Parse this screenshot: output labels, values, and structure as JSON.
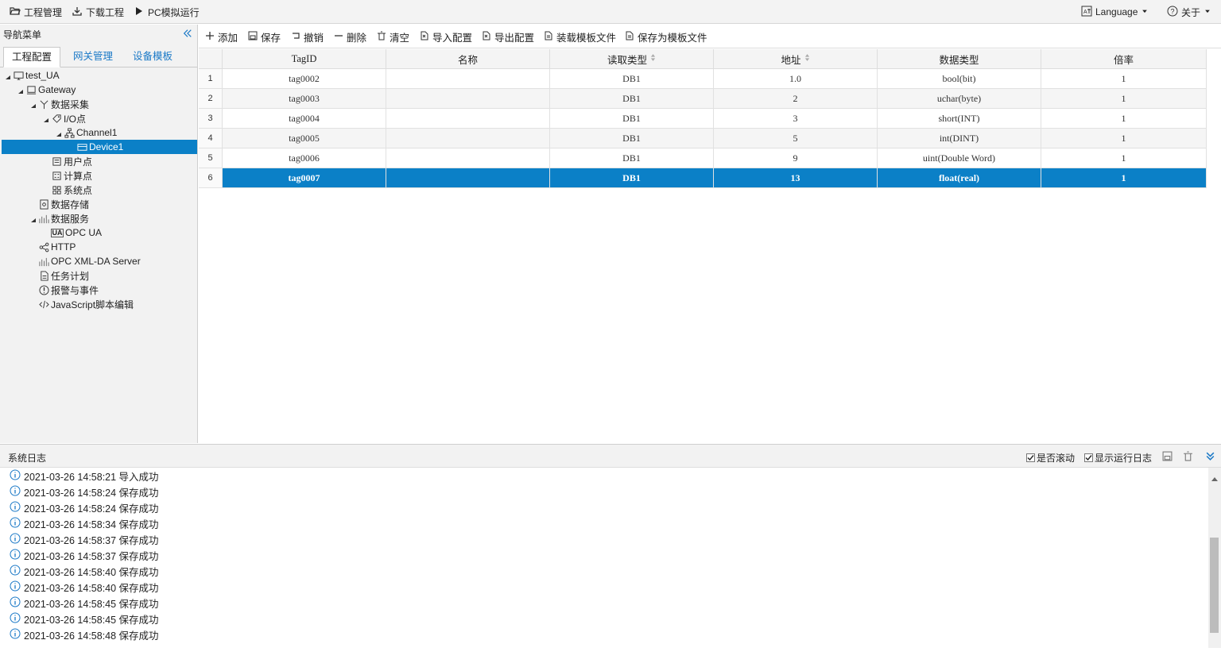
{
  "topbar": {
    "project": "工程管理",
    "download": "下载工程",
    "simulate": "PC模拟运行",
    "language": "Language",
    "about": "关于"
  },
  "nav": {
    "title": "导航菜单",
    "tabs": [
      "工程配置",
      "网关管理",
      "设备模板"
    ],
    "tree": [
      {
        "label": "test_UA",
        "icon": "monitor-icon"
      },
      {
        "label": "Gateway",
        "icon": "gateway-icon"
      },
      {
        "label": "数据采集",
        "icon": "collect-icon"
      },
      {
        "label": "I/O点",
        "icon": "tag-icon"
      },
      {
        "label": "Channel1",
        "icon": "channel-icon"
      },
      {
        "label": "Device1",
        "icon": "device-icon"
      },
      {
        "label": "用户点",
        "icon": "user-point-icon"
      },
      {
        "label": "计算点",
        "icon": "calc-point-icon"
      },
      {
        "label": "系统点",
        "icon": "system-point-icon"
      },
      {
        "label": "数据存储",
        "icon": "storage-icon"
      },
      {
        "label": "数据服务",
        "icon": "service-icon"
      },
      {
        "label": "OPC UA",
        "icon": "opcua-icon",
        "badge": "UA"
      },
      {
        "label": "HTTP",
        "icon": "share-icon"
      },
      {
        "label": "OPC XML-DA Server",
        "icon": "chart-icon"
      },
      {
        "label": "任务计划",
        "icon": "document-icon"
      },
      {
        "label": "报警与事件",
        "icon": "alert-icon"
      },
      {
        "label": "JavaScript脚本编辑",
        "icon": "code-icon"
      }
    ]
  },
  "toolbar": {
    "add": "添加",
    "save": "保存",
    "undo": "撤销",
    "delete": "删除",
    "clear": "清空",
    "import": "导入配置",
    "export": "导出配置",
    "load_template": "装载模板文件",
    "save_template": "保存为模板文件"
  },
  "grid": {
    "columns": [
      "TagID",
      "名称",
      "读取类型",
      "地址",
      "数据类型",
      "倍率"
    ],
    "rows": [
      {
        "n": "1",
        "tagid": "tag0002",
        "name": "",
        "read": "DB1",
        "addr": "1.0",
        "dtype": "bool(bit)",
        "rate": "1"
      },
      {
        "n": "2",
        "tagid": "tag0003",
        "name": "",
        "read": "DB1",
        "addr": "2",
        "dtype": "uchar(byte)",
        "rate": "1"
      },
      {
        "n": "3",
        "tagid": "tag0004",
        "name": "",
        "read": "DB1",
        "addr": "3",
        "dtype": "short(INT)",
        "rate": "1"
      },
      {
        "n": "4",
        "tagid": "tag0005",
        "name": "",
        "read": "DB1",
        "addr": "5",
        "dtype": "int(DINT)",
        "rate": "1"
      },
      {
        "n": "5",
        "tagid": "tag0006",
        "name": "",
        "read": "DB1",
        "addr": "9",
        "dtype": "uint(Double Word)",
        "rate": "1"
      },
      {
        "n": "6",
        "tagid": "tag0007",
        "name": "",
        "read": "DB1",
        "addr": "13",
        "dtype": "float(real)",
        "rate": "1"
      }
    ]
  },
  "log": {
    "title": "系统日志",
    "auto_scroll": "是否滚动",
    "show_runtime": "显示运行日志",
    "entries": [
      "2021-03-26 14:58:21 导入成功",
      "2021-03-26 14:58:24 保存成功",
      "2021-03-26 14:58:24 保存成功",
      "2021-03-26 14:58:34 保存成功",
      "2021-03-26 14:58:37 保存成功",
      "2021-03-26 14:58:37 保存成功",
      "2021-03-26 14:58:40 保存成功",
      "2021-03-26 14:58:40 保存成功",
      "2021-03-26 14:58:45 保存成功",
      "2021-03-26 14:58:45 保存成功",
      "2021-03-26 14:58:48 保存成功"
    ]
  },
  "colors": {
    "accent": "#0b80c7",
    "tab_link": "#1b79c7"
  }
}
